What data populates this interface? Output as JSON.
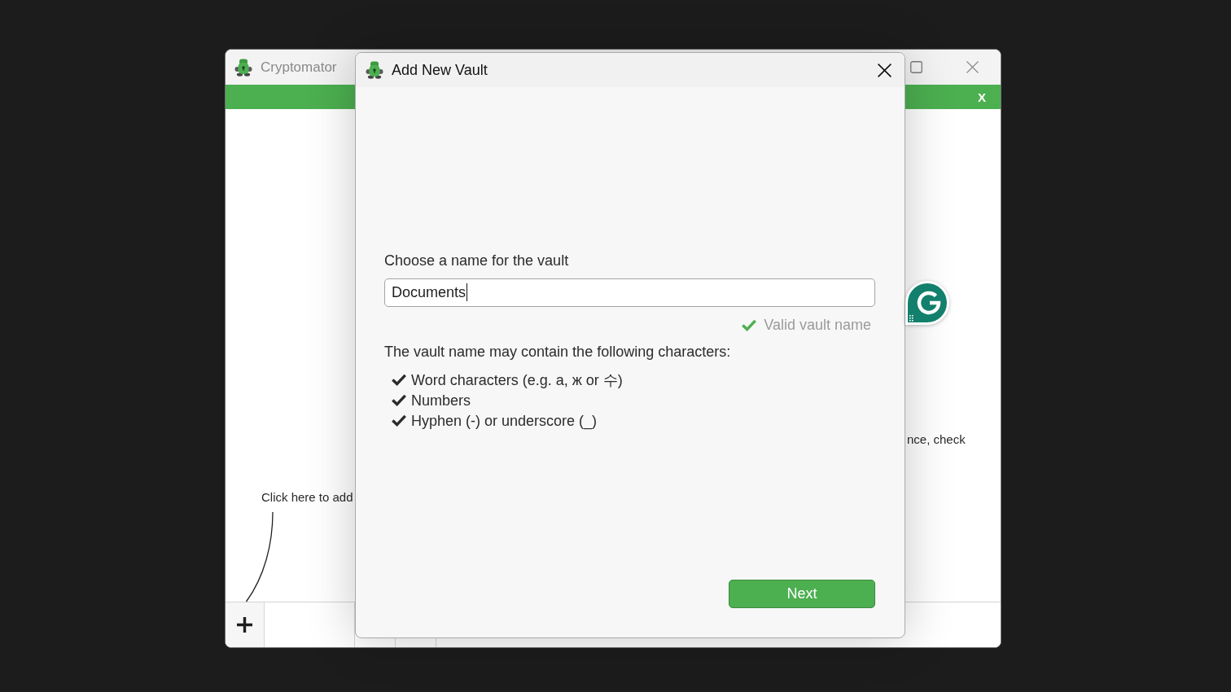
{
  "main_window": {
    "title": "Cryptomator",
    "active": false,
    "banner": {
      "close_label": "X"
    },
    "add_vault_hint": "Click here to add",
    "side_text": "nce, check"
  },
  "dialog": {
    "title": "Add New Vault",
    "active": true,
    "name_label": "Choose a name for the vault",
    "name_field": {
      "value": "Documents",
      "focused": true
    },
    "validation": {
      "valid": true,
      "message": "Valid vault name"
    },
    "rules_heading": "The vault name may contain the following characters:",
    "rules": [
      "Word characters (e.g. a, ж or 수)",
      "Numbers",
      "Hyphen (-) or underscore (_)"
    ],
    "buttons": [
      {
        "label": "Next",
        "kind": "primary"
      }
    ]
  }
}
